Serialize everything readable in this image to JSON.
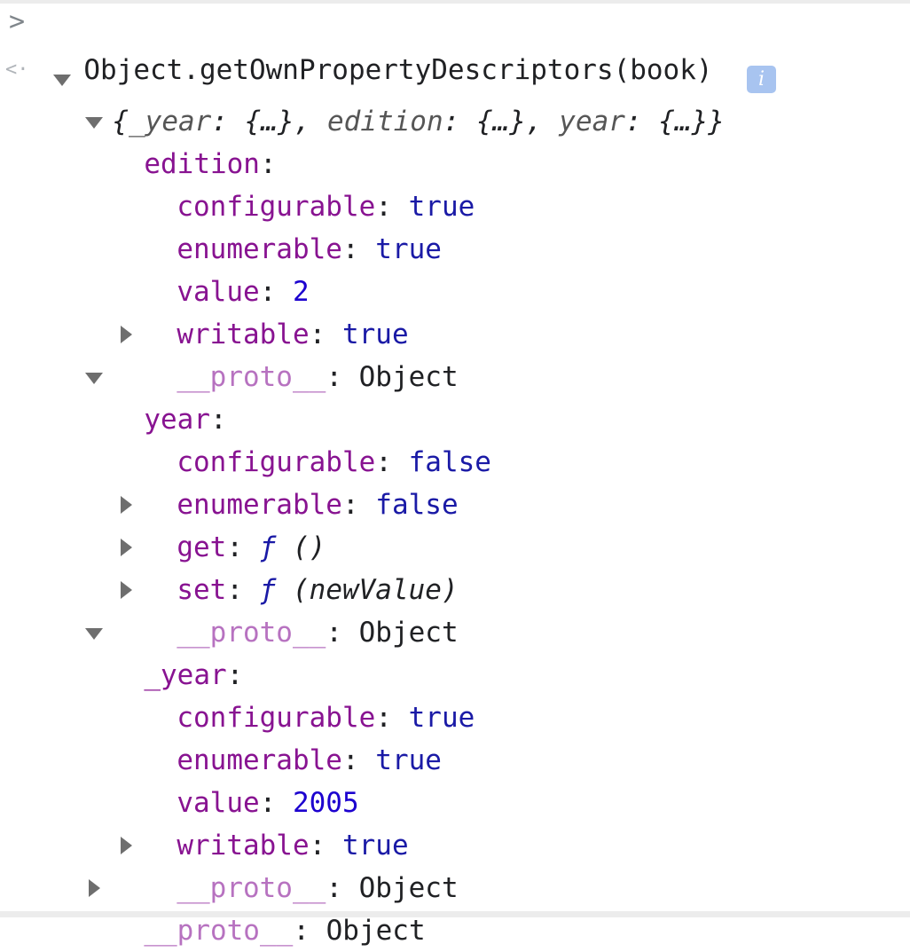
{
  "console": {
    "prompt_symbol": ">",
    "input_command": "Object.getOwnPropertyDescriptors(book)",
    "result_symbol": "<·",
    "summary": {
      "open": "{",
      "close": "}",
      "entries": [
        {
          "key": "_year",
          "sep": ": ",
          "value": "{…}",
          "comma": ", "
        },
        {
          "key": "edition",
          "sep": ": ",
          "value": "{…}",
          "comma": ", "
        },
        {
          "key": "year",
          "sep": ": ",
          "value": "{…}",
          "comma": ""
        }
      ]
    },
    "info_badge": "i",
    "tree": {
      "edition": {
        "label": "edition",
        "colon": ":",
        "props": [
          {
            "key": "configurable",
            "sep": ": ",
            "value": "true"
          },
          {
            "key": "enumerable",
            "sep": ": ",
            "value": "true"
          },
          {
            "key": "value",
            "sep": ": ",
            "value": "2"
          },
          {
            "key": "writable",
            "sep": ": ",
            "value": "true"
          }
        ],
        "proto": {
          "key": "__proto__",
          "sep": ": ",
          "value": "Object"
        }
      },
      "year": {
        "label": "year",
        "colon": ":",
        "props": [
          {
            "key": "configurable",
            "sep": ": ",
            "value": "false"
          },
          {
            "key": "enumerable",
            "sep": ": ",
            "value": "false"
          }
        ],
        "get": {
          "key": "get",
          "sep": ": ",
          "f": "ƒ",
          "sig": " ()"
        },
        "set": {
          "key": "set",
          "sep": ": ",
          "f": "ƒ",
          "sig": " (newValue)"
        },
        "proto": {
          "key": "__proto__",
          "sep": ": ",
          "value": "Object"
        }
      },
      "_year": {
        "label": "_year",
        "colon": ":",
        "props": [
          {
            "key": "configurable",
            "sep": ": ",
            "value": "true"
          },
          {
            "key": "enumerable",
            "sep": ": ",
            "value": "true"
          },
          {
            "key": "value",
            "sep": ": ",
            "value": "2005"
          },
          {
            "key": "writable",
            "sep": ": ",
            "value": "true"
          }
        ],
        "proto": {
          "key": "__proto__",
          "sep": ": ",
          "value": "Object"
        }
      },
      "root_proto": {
        "key": "__proto__",
        "sep": ": ",
        "value": "Object"
      }
    }
  }
}
